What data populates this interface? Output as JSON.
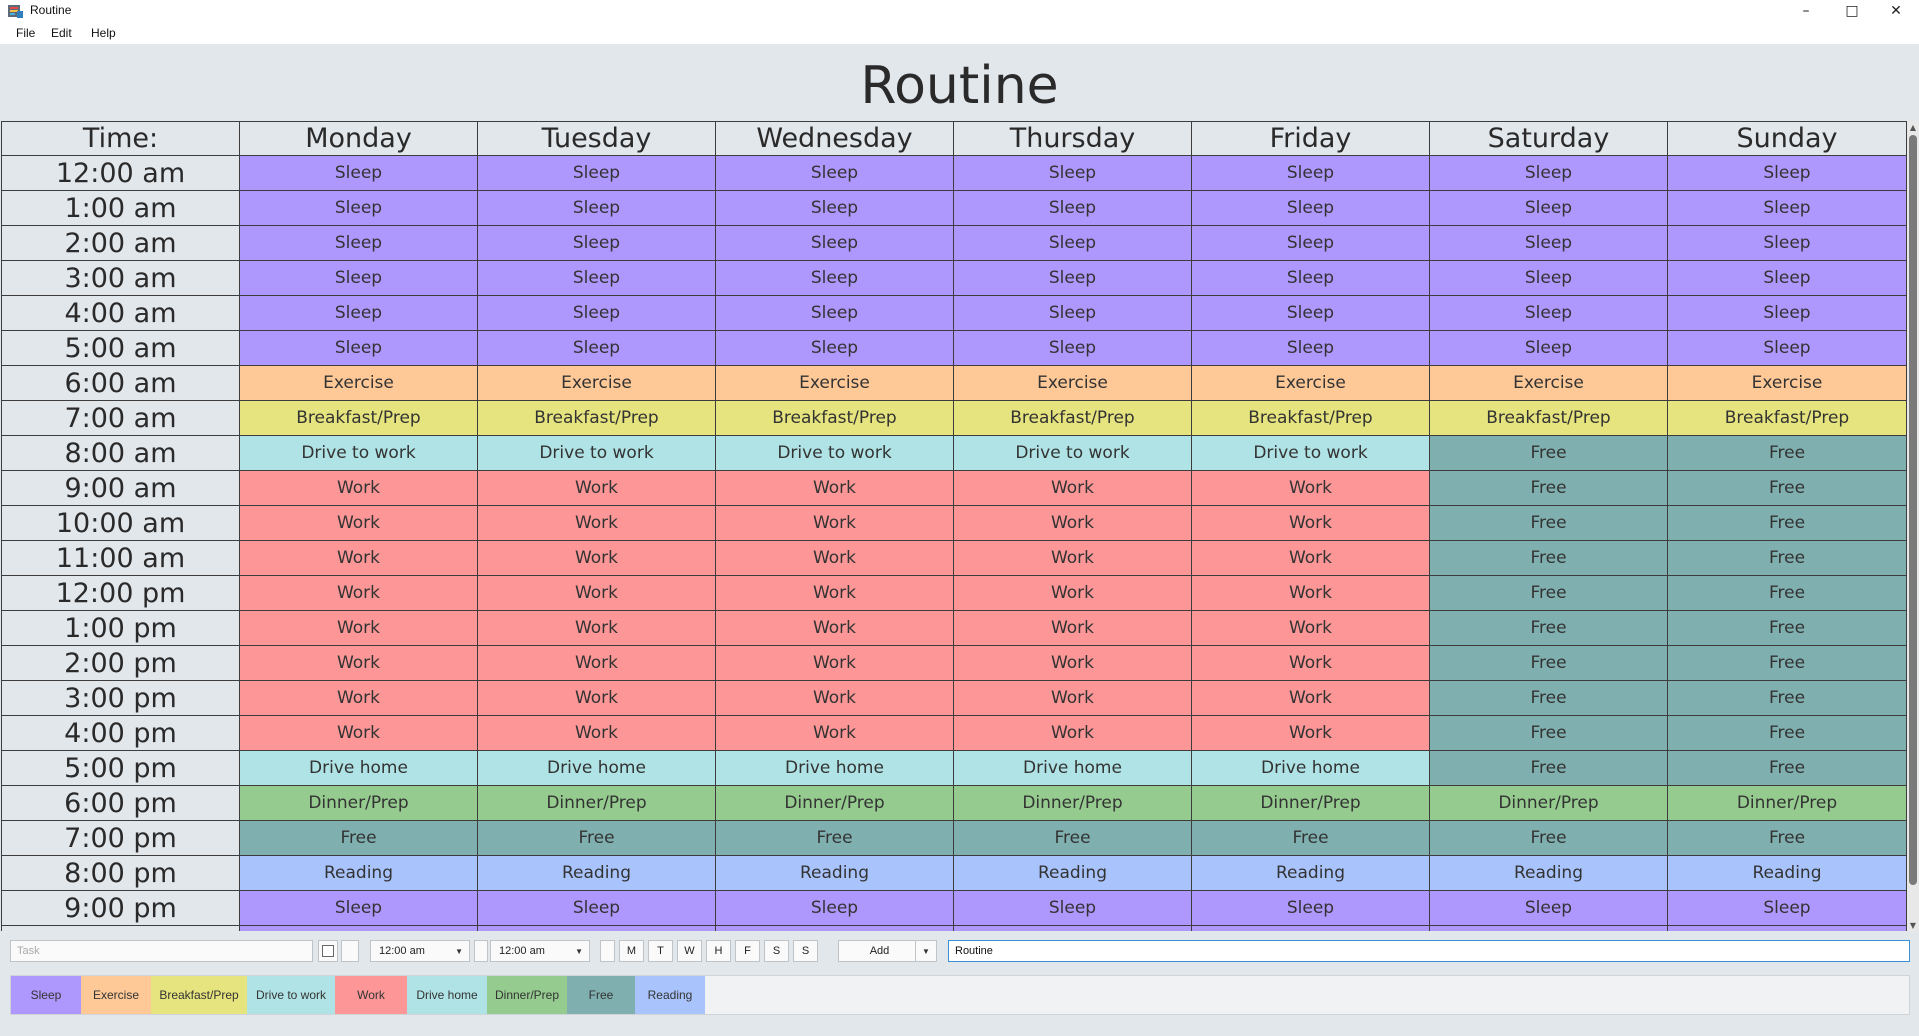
{
  "window": {
    "title": "Routine"
  },
  "menu": [
    "File",
    "Edit",
    "Help"
  ],
  "heading": "Routine",
  "columns": [
    "Time:",
    "Monday",
    "Tuesday",
    "Wednesday",
    "Thursday",
    "Friday",
    "Saturday",
    "Sunday"
  ],
  "times": [
    "12:00 am",
    "1:00 am",
    "2:00 am",
    "3:00 am",
    "4:00 am",
    "5:00 am",
    "6:00 am",
    "7:00 am",
    "8:00 am",
    "9:00 am",
    "10:00 am",
    "11:00 am",
    "12:00 pm",
    "1:00 pm",
    "2:00 pm",
    "3:00 pm",
    "4:00 pm",
    "5:00 pm",
    "6:00 pm",
    "7:00 pm",
    "8:00 pm",
    "9:00 pm"
  ],
  "schedule": [
    [
      "Sleep",
      "Sleep",
      "Sleep",
      "Sleep",
      "Sleep",
      "Sleep",
      "Sleep"
    ],
    [
      "Sleep",
      "Sleep",
      "Sleep",
      "Sleep",
      "Sleep",
      "Sleep",
      "Sleep"
    ],
    [
      "Sleep",
      "Sleep",
      "Sleep",
      "Sleep",
      "Sleep",
      "Sleep",
      "Sleep"
    ],
    [
      "Sleep",
      "Sleep",
      "Sleep",
      "Sleep",
      "Sleep",
      "Sleep",
      "Sleep"
    ],
    [
      "Sleep",
      "Sleep",
      "Sleep",
      "Sleep",
      "Sleep",
      "Sleep",
      "Sleep"
    ],
    [
      "Sleep",
      "Sleep",
      "Sleep",
      "Sleep",
      "Sleep",
      "Sleep",
      "Sleep"
    ],
    [
      "Exercise",
      "Exercise",
      "Exercise",
      "Exercise",
      "Exercise",
      "Exercise",
      "Exercise"
    ],
    [
      "Breakfast/Prep",
      "Breakfast/Prep",
      "Breakfast/Prep",
      "Breakfast/Prep",
      "Breakfast/Prep",
      "Breakfast/Prep",
      "Breakfast/Prep"
    ],
    [
      "Drive to work",
      "Drive to work",
      "Drive to work",
      "Drive to work",
      "Drive to work",
      "Free",
      "Free"
    ],
    [
      "Work",
      "Work",
      "Work",
      "Work",
      "Work",
      "Free",
      "Free"
    ],
    [
      "Work",
      "Work",
      "Work",
      "Work",
      "Work",
      "Free",
      "Free"
    ],
    [
      "Work",
      "Work",
      "Work",
      "Work",
      "Work",
      "Free",
      "Free"
    ],
    [
      "Work",
      "Work",
      "Work",
      "Work",
      "Work",
      "Free",
      "Free"
    ],
    [
      "Work",
      "Work",
      "Work",
      "Work",
      "Work",
      "Free",
      "Free"
    ],
    [
      "Work",
      "Work",
      "Work",
      "Work",
      "Work",
      "Free",
      "Free"
    ],
    [
      "Work",
      "Work",
      "Work",
      "Work",
      "Work",
      "Free",
      "Free"
    ],
    [
      "Work",
      "Work",
      "Work",
      "Work",
      "Work",
      "Free",
      "Free"
    ],
    [
      "Drive home",
      "Drive home",
      "Drive home",
      "Drive home",
      "Drive home",
      "Free",
      "Free"
    ],
    [
      "Dinner/Prep",
      "Dinner/Prep",
      "Dinner/Prep",
      "Dinner/Prep",
      "Dinner/Prep",
      "Dinner/Prep",
      "Dinner/Prep"
    ],
    [
      "Free",
      "Free",
      "Free",
      "Free",
      "Free",
      "Free",
      "Free"
    ],
    [
      "Reading",
      "Reading",
      "Reading",
      "Reading",
      "Reading",
      "Reading",
      "Reading"
    ],
    [
      "Sleep",
      "Sleep",
      "Sleep",
      "Sleep",
      "Sleep",
      "Sleep",
      "Sleep"
    ]
  ],
  "task_colors": {
    "Sleep": "#ae97fd",
    "Exercise": "#fec897",
    "Breakfast/Prep": "#e6e47e",
    "Drive to work": "#b0e3e5",
    "Work": "#fd9797",
    "Drive home": "#b0e3e5",
    "Dinner/Prep": "#95cb8f",
    "Free": "#7fb0af",
    "Reading": "#a9c4fc"
  },
  "controls": {
    "task_placeholder": "Task",
    "start_time": "12:00 am",
    "end_time": "12:00 am",
    "days": [
      "M",
      "T",
      "W",
      "H",
      "F",
      "S",
      "S"
    ],
    "add_label": "Add",
    "routine_name": "Routine"
  },
  "legend": [
    "Sleep",
    "Exercise",
    "Breakfast/Prep",
    "Drive to work",
    "Work",
    "Drive home",
    "Dinner/Prep",
    "Free",
    "Reading"
  ]
}
